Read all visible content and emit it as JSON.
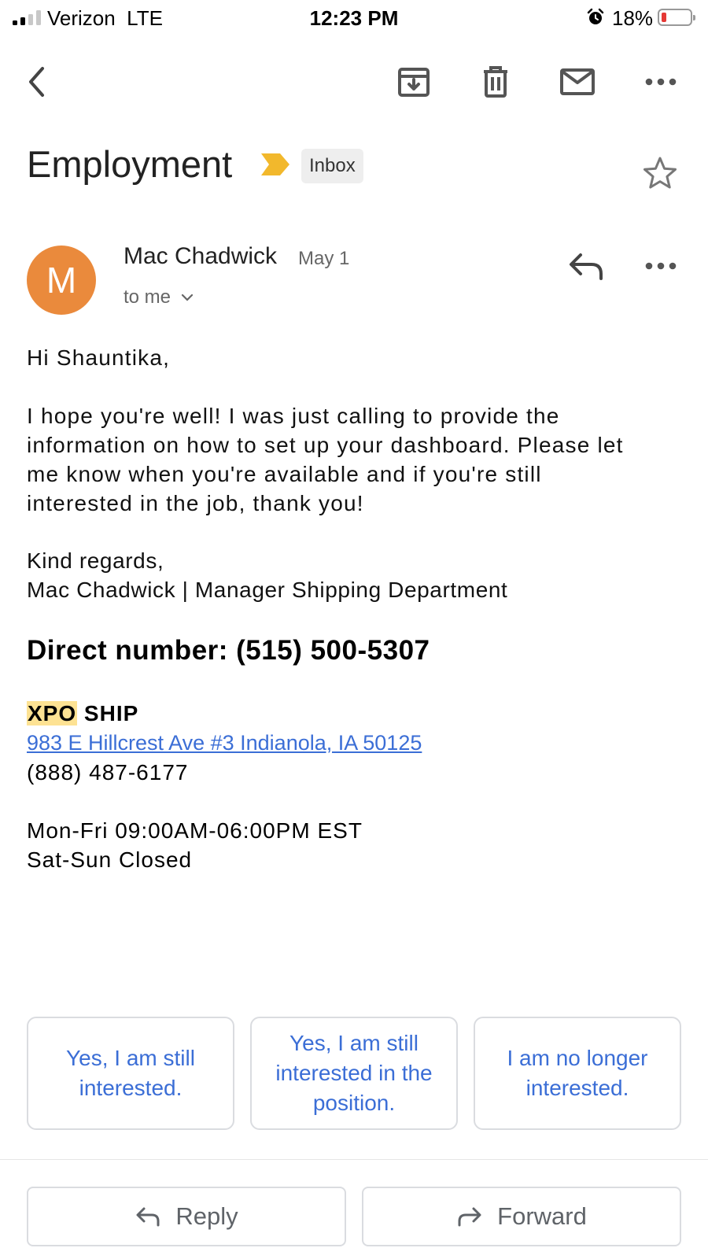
{
  "status_bar": {
    "carrier": "Verizon  LTE",
    "time": "12:23 PM",
    "battery_percent": "18%",
    "battery_level": 0.18,
    "signal_bars": 2
  },
  "toolbar": {
    "icons": [
      "back-arrow-icon",
      "archive-icon",
      "trash-icon",
      "mail-icon",
      "more-horizontal-icon"
    ]
  },
  "email": {
    "subject": "Employment",
    "label": "Inbox",
    "importance_color": "#f2b82c",
    "sender": {
      "initial": "M",
      "name": "Mac Chadwick",
      "date": "May 1",
      "recipient": "to me",
      "avatar_color": "#ea8a3c"
    },
    "body": {
      "greeting": "Hi Shauntika,",
      "paragraph_lines": [
        "I hope you're well! I was just calling to provide the",
        "information on how to set up your dashboard. Please let",
        "me know when you're available and if you're still",
        "interested in the job, thank you!"
      ],
      "closing": "Kind regards,",
      "signature": "Mac Chadwick | Manager Shipping Department",
      "direct_number": "Direct number: (515) 500-5307",
      "company_highlight": "XPO",
      "company_rest": " SHIP",
      "address": "983 E Hillcrest Ave #3 Indianola, IA 50125",
      "phone": "(888) 487-6177",
      "hours_weekday": "Mon-Fri 09:00AM-06:00PM EST",
      "hours_weekend": "Sat-Sun Closed"
    }
  },
  "smart_replies": [
    "Yes, I am still interested.",
    "Yes, I am still interested in the position.",
    "I am no longer interested."
  ],
  "actions": {
    "reply": "Reply",
    "forward": "Forward"
  },
  "colors": {
    "link": "#3b6ed6",
    "highlight": "#fde293"
  }
}
